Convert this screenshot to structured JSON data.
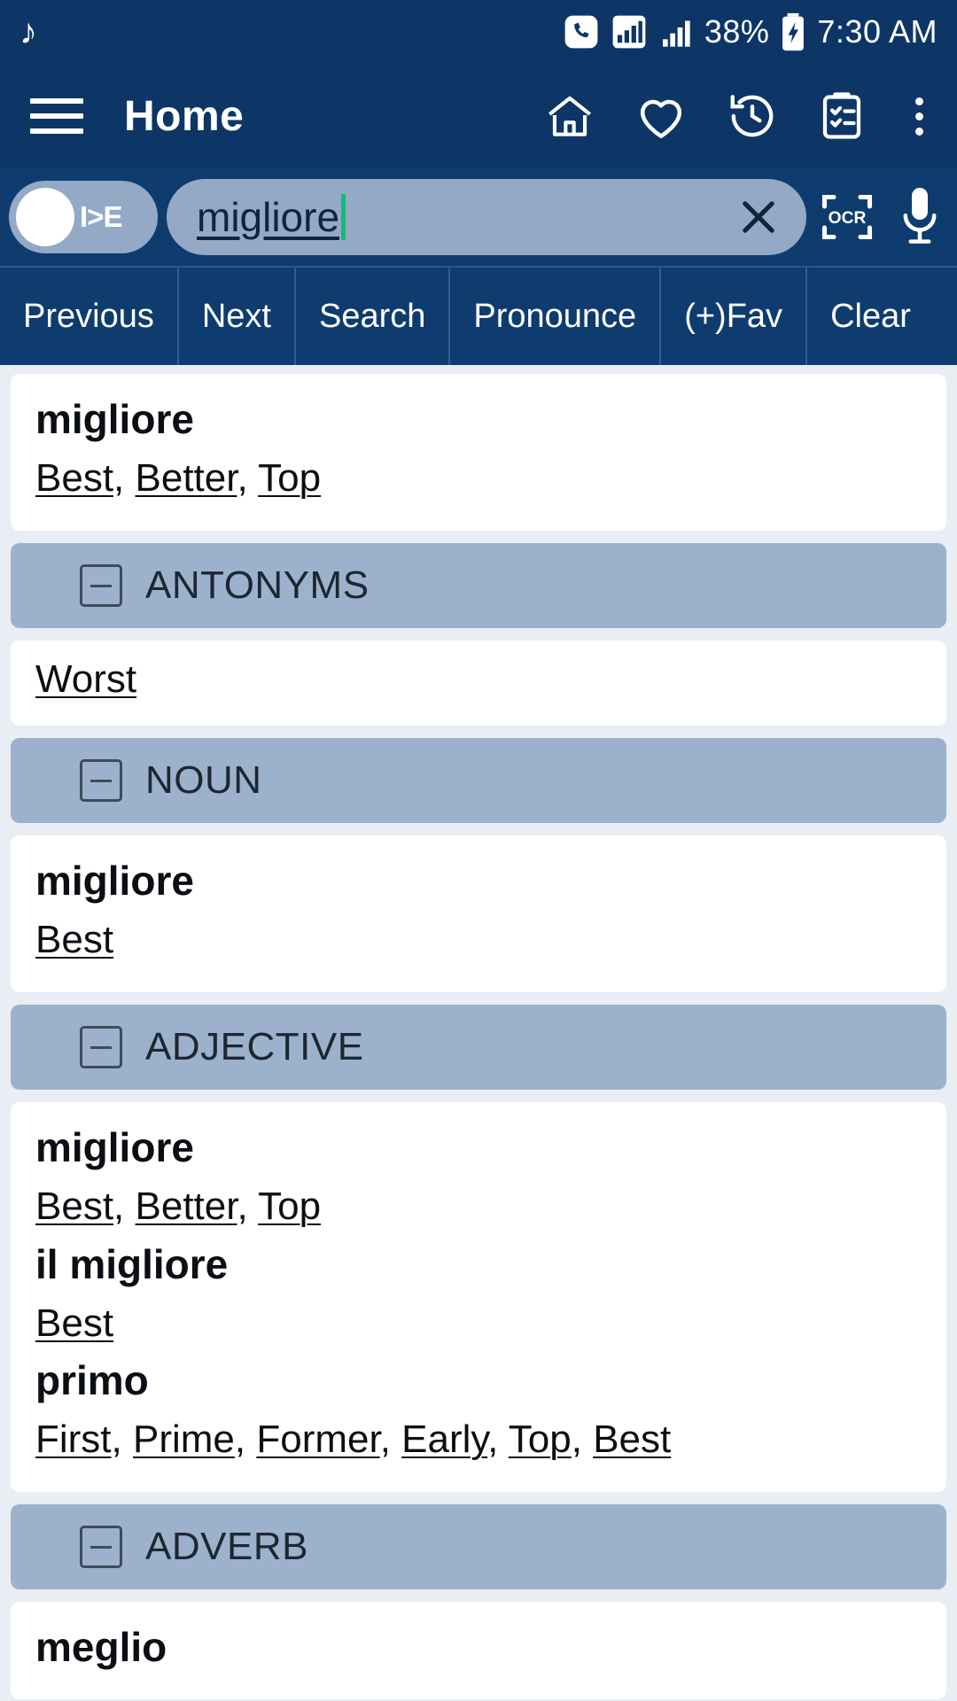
{
  "status_bar": {
    "music_icon": "music-note-icon",
    "phone_icon": "phone-call-icon",
    "signal_icon_1": "cellular-signal-icon",
    "signal_icon_2": "cellular-signal-icon",
    "battery_percent": "38%",
    "battery_icon": "battery-charging-icon",
    "time": "7:30 AM"
  },
  "app_bar": {
    "menu_icon": "hamburger-menu-icon",
    "title": "Home",
    "actions": [
      {
        "name": "home-icon",
        "label": "Home"
      },
      {
        "name": "favorites-heart-icon",
        "label": "Favorites"
      },
      {
        "name": "history-clock-icon",
        "label": "History"
      },
      {
        "name": "clipboard-list-icon",
        "label": "Word List"
      },
      {
        "name": "more-options-icon",
        "label": "More options"
      }
    ]
  },
  "search": {
    "lang_toggle_label": "I>E",
    "value": "migliore",
    "placeholder": "migliore",
    "clear_icon": "close-x-icon",
    "ocr_icon": "ocr-scan-icon",
    "ocr_label": "OCR",
    "mic_icon": "microphone-icon"
  },
  "action_bar": {
    "buttons": [
      "Previous",
      "Next",
      "Search",
      "Pronounce",
      "(+)Fav",
      "Clear"
    ]
  },
  "results": [
    {
      "type": "entry",
      "headword": "migliore",
      "meanings": [
        {
          "text": "Best",
          "link": true
        },
        {
          "text": ", ",
          "link": false
        },
        {
          "text": "Better",
          "link": true
        },
        {
          "text": ", ",
          "link": false
        },
        {
          "text": "Top",
          "link": true
        }
      ]
    },
    {
      "type": "section",
      "title": "ANTONYMS",
      "collapse_icon": "collapse-minus-icon",
      "entries": [
        {
          "headword": null,
          "meanings": [
            {
              "text": "Worst",
              "link": true
            }
          ]
        }
      ]
    },
    {
      "type": "section",
      "title": "NOUN",
      "collapse_icon": "collapse-minus-icon",
      "entries": [
        {
          "headword": "migliore",
          "meanings": [
            {
              "text": "Best",
              "link": true
            }
          ]
        }
      ]
    },
    {
      "type": "section",
      "title": "ADJECTIVE",
      "collapse_icon": "collapse-minus-icon",
      "entries": [
        {
          "headword": "migliore",
          "meanings": [
            {
              "text": "Best",
              "link": true
            },
            {
              "text": ", ",
              "link": false
            },
            {
              "text": "Better",
              "link": true
            },
            {
              "text": ", ",
              "link": false
            },
            {
              "text": "Top",
              "link": true
            }
          ]
        },
        {
          "headword": "il migliore",
          "meanings": [
            {
              "text": "Best",
              "link": true
            }
          ]
        },
        {
          "headword": "primo",
          "meanings": [
            {
              "text": "First",
              "link": true
            },
            {
              "text": ", ",
              "link": false
            },
            {
              "text": "Prime",
              "link": true
            },
            {
              "text": ", ",
              "link": false
            },
            {
              "text": "Former",
              "link": true
            },
            {
              "text": ", ",
              "link": false
            },
            {
              "text": "Early",
              "link": true
            },
            {
              "text": ", ",
              "link": false
            },
            {
              "text": "Top",
              "link": true
            },
            {
              "text": ", ",
              "link": false
            },
            {
              "text": "Best",
              "link": true
            }
          ]
        }
      ]
    },
    {
      "type": "section",
      "title": "ADVERB",
      "collapse_icon": "collapse-minus-icon",
      "entries": [
        {
          "headword": "meglio",
          "meanings": []
        }
      ]
    }
  ],
  "colors": {
    "app_bar_bg": "#0d3666",
    "search_bar_bg": "#0f3c6e",
    "section_header_bg": "#9cb2cc",
    "field_bg": "#93a9c6",
    "content_bg": "#e9eef4",
    "caret": "#18b878",
    "card_bg": "#ffffff"
  }
}
